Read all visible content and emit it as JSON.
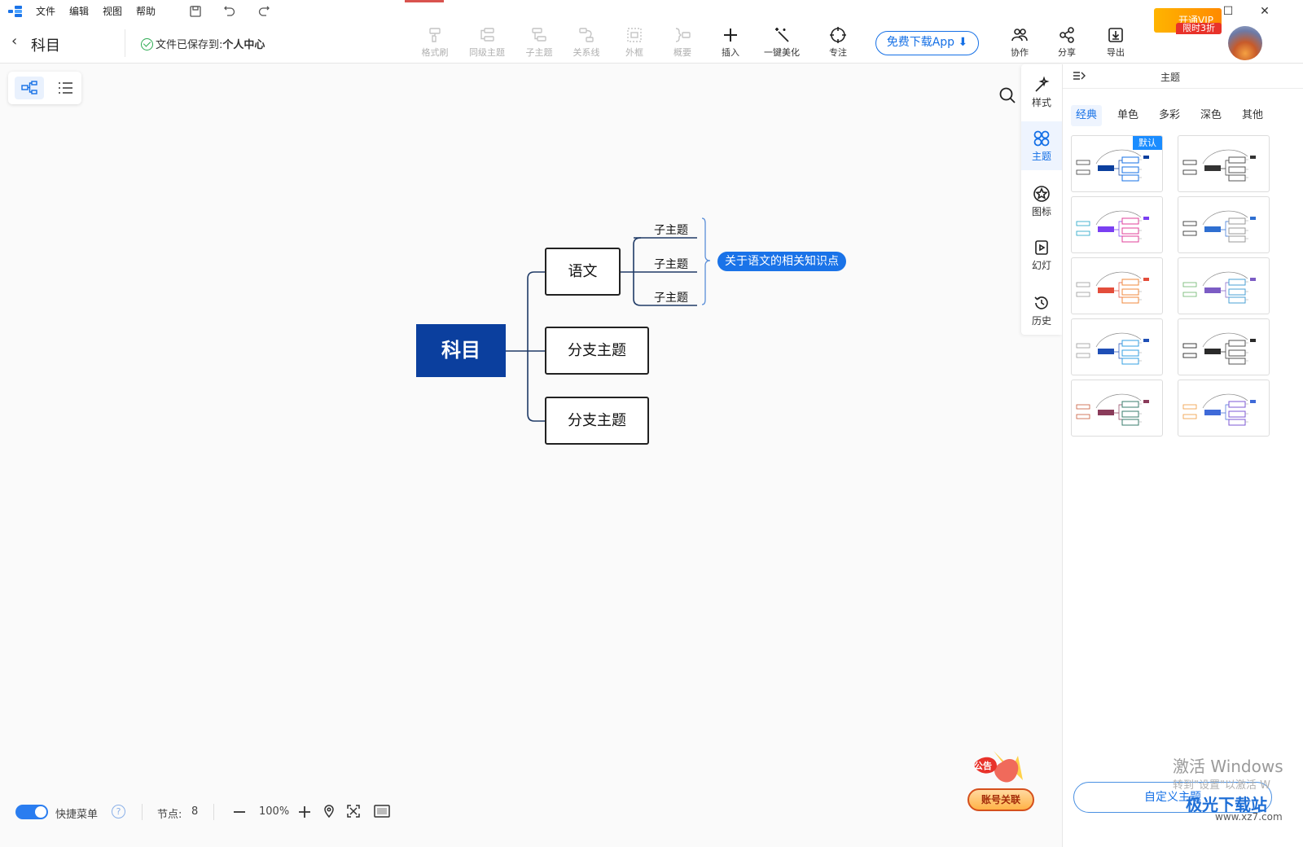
{
  "menu": {
    "items": [
      "文件",
      "编辑",
      "视图",
      "帮助"
    ]
  },
  "header": {
    "back_label": "<",
    "title": "科目",
    "saved_prefix": "文件已保存到:",
    "saved_location": "个人中心"
  },
  "toolbar": {
    "tools": [
      {
        "label": "格式刷",
        "icon": "format-brush-icon",
        "enabled": false
      },
      {
        "label": "同级主题",
        "icon": "sibling-topic-icon",
        "enabled": false
      },
      {
        "label": "子主题",
        "icon": "subtopic-icon",
        "enabled": false
      },
      {
        "label": "关系线",
        "icon": "relation-line-icon",
        "enabled": false
      },
      {
        "label": "外框",
        "icon": "boundary-icon",
        "enabled": false
      },
      {
        "label": "概要",
        "icon": "summary-icon",
        "enabled": false
      },
      {
        "label": "插入",
        "icon": "plus-icon",
        "enabled": true
      },
      {
        "label": "一键美化",
        "icon": "magic-wand-icon",
        "enabled": true
      },
      {
        "label": "专注",
        "icon": "focus-icon",
        "enabled": true
      }
    ],
    "download_label": "免费下载App",
    "actions": [
      {
        "label": "协作",
        "icon": "collaborate-icon"
      },
      {
        "label": "分享",
        "icon": "share-icon"
      },
      {
        "label": "导出",
        "icon": "export-icon"
      }
    ],
    "vip_label": "开通VIP",
    "vip_tag": "限时3折"
  },
  "mindmap": {
    "root": "科目",
    "branches": [
      "语文",
      "分支主题",
      "分支主题"
    ],
    "subtopics": [
      "子主题",
      "子主题",
      "子主题"
    ],
    "summary": "关于语文的相关知识点"
  },
  "side_strip": {
    "items": [
      {
        "label": "样式",
        "icon": "style-icon",
        "active": false
      },
      {
        "label": "主题",
        "icon": "theme-icon",
        "active": true
      },
      {
        "label": "图标",
        "icon": "icon-library-icon",
        "active": false
      },
      {
        "label": "幻灯",
        "icon": "slideshow-icon",
        "active": false
      },
      {
        "label": "历史",
        "icon": "history-icon",
        "active": false
      }
    ]
  },
  "panel": {
    "title": "主题",
    "tabs": [
      "经典",
      "单色",
      "多彩",
      "深色",
      "其他"
    ],
    "active_tab": "经典",
    "default_badge": "默认",
    "custom_button": "自定义主题",
    "theme_count": 10
  },
  "status": {
    "quick_menu_label": "快捷菜单",
    "quick_menu_on": true,
    "help_label": "?",
    "nodes_label": "节点:",
    "nodes_value": "8",
    "zoom": "100%"
  },
  "overlay": {
    "notice_label": "公告",
    "account_link_label": "账号关联",
    "watermark_line1": "激活 Windows",
    "watermark_line2": "转到\"设置\"以激活 W",
    "brand": "极光下载站",
    "brand_url": "www.xz7.com"
  },
  "colors": {
    "accent": "#1570e6",
    "root_fill": "#0b3f9e",
    "summary_fill": "#1a73e8",
    "vip": "#ff9900"
  }
}
